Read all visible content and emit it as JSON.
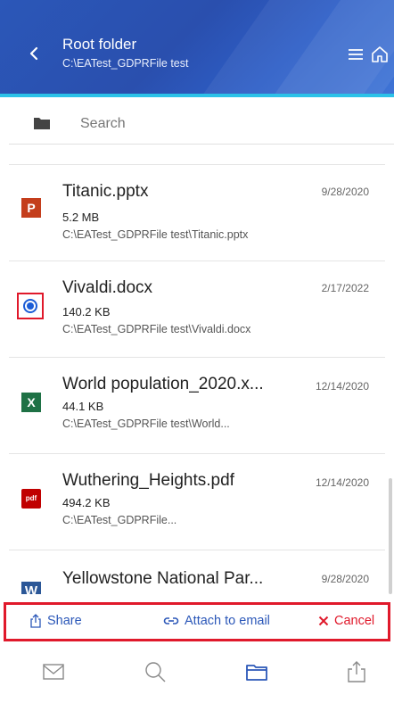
{
  "header": {
    "title": "Root folder",
    "subtitle": "C:\\EATest_GDPRFile test",
    "back_icon": "chevron-left-icon",
    "menu_icon": "hamburger-menu-icon",
    "home_icon": "home-icon"
  },
  "search": {
    "placeholder": "Search",
    "icon": "folder-icon"
  },
  "files": [
    {
      "name": "Titanic.pptx",
      "size": "5.2 MB",
      "path": "C:\\EATest_GDPRFile test\\Titanic.pptx",
      "date": "9/28/2020",
      "icon": "powerpoint-icon",
      "icon_text": "P"
    },
    {
      "name": "Vivaldi.docx",
      "size": "140.2 KB",
      "path": "C:\\EATest_GDPRFile test\\Vivaldi.docx",
      "date": "2/17/2022",
      "icon": "radio-selected-icon"
    },
    {
      "name": "World population_2020.x...",
      "size": "44.1 KB",
      "path": "C:\\EATest_GDPRFile test\\World...",
      "date": "12/14/2020",
      "icon": "excel-icon",
      "icon_text": "X"
    },
    {
      "name": "Wuthering_Heights.pdf",
      "size": "494.2 KB",
      "path": "C:\\EATest_GDPRFile...",
      "date": "12/14/2020",
      "icon": "pdf-icon",
      "icon_text": "pdf"
    },
    {
      "name": "Yellowstone National Par...",
      "size": "",
      "path": "",
      "date": "9/28/2020",
      "icon": "word-icon",
      "icon_text": "W"
    }
  ],
  "actions": {
    "share_label": "Share",
    "attach_label": "Attach to email",
    "cancel_label": "Cancel"
  },
  "bottom_nav": [
    "mail-icon",
    "search-icon",
    "folder-icon",
    "share-icon"
  ],
  "colors": {
    "header_bg": "#2b57b8",
    "accent": "#2cc2e8",
    "action_blue": "#2b57b8",
    "highlight_red": "#e0192b"
  }
}
